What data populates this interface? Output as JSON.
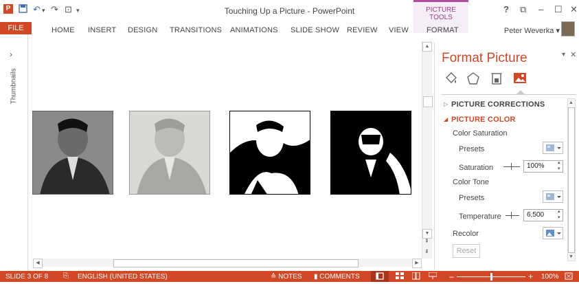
{
  "window": {
    "title": "Touching Up a Picture - PowerPoint",
    "contextual_tab_group": "PICTURE TOOLS",
    "help": "?",
    "restore": "⧉",
    "minimize": "–",
    "maximize": "☐",
    "close": "✕"
  },
  "qat": {
    "app_icon": "P",
    "save": "💾",
    "undo": "↶",
    "undo_drop": "▾",
    "redo": "↷",
    "start": "⊡",
    "customize": "▾"
  },
  "ribbon": {
    "tabs": [
      "FILE",
      "HOME",
      "INSERT",
      "DESIGN",
      "TRANSITIONS",
      "ANIMATIONS",
      "SLIDE SHOW",
      "REVIEW",
      "VIEW",
      "FORMAT"
    ],
    "user": "Peter Weverka ▾"
  },
  "thumbnails": {
    "label": "Thumbnails",
    "expand": "›"
  },
  "format_pane": {
    "title": "Format Picture",
    "pin": "▾",
    "close": "✕",
    "icons": [
      "fill-line-icon",
      "effects-icon",
      "size-properties-icon",
      "picture-icon"
    ],
    "sections": {
      "corrections": "PICTURE CORRECTIONS",
      "color": "PICTURE COLOR"
    },
    "color_saturation_label": "Color Saturation",
    "presets_label": "Presets",
    "saturation_label": "Saturation",
    "saturation_value": "100%",
    "color_tone_label": "Color Tone",
    "presets2_label": "Presets",
    "temperature_label": "Temperature",
    "temperature_value": "6,500",
    "recolor_label": "Recolor",
    "reset_label": "Reset"
  },
  "status": {
    "slide": "SLIDE 3 OF 8",
    "language": "ENGLISH (UNITED STATES)",
    "notes": "≙ NOTES",
    "comments": "▮ COMMENTS",
    "zoom": "100%",
    "zoom_fraction": 0.5
  },
  "pictures": [
    "original",
    "washout",
    "black-white-high",
    "black-white-low"
  ],
  "colors": {
    "accent": "#d24726",
    "picture_tools": "#b04fa0"
  }
}
